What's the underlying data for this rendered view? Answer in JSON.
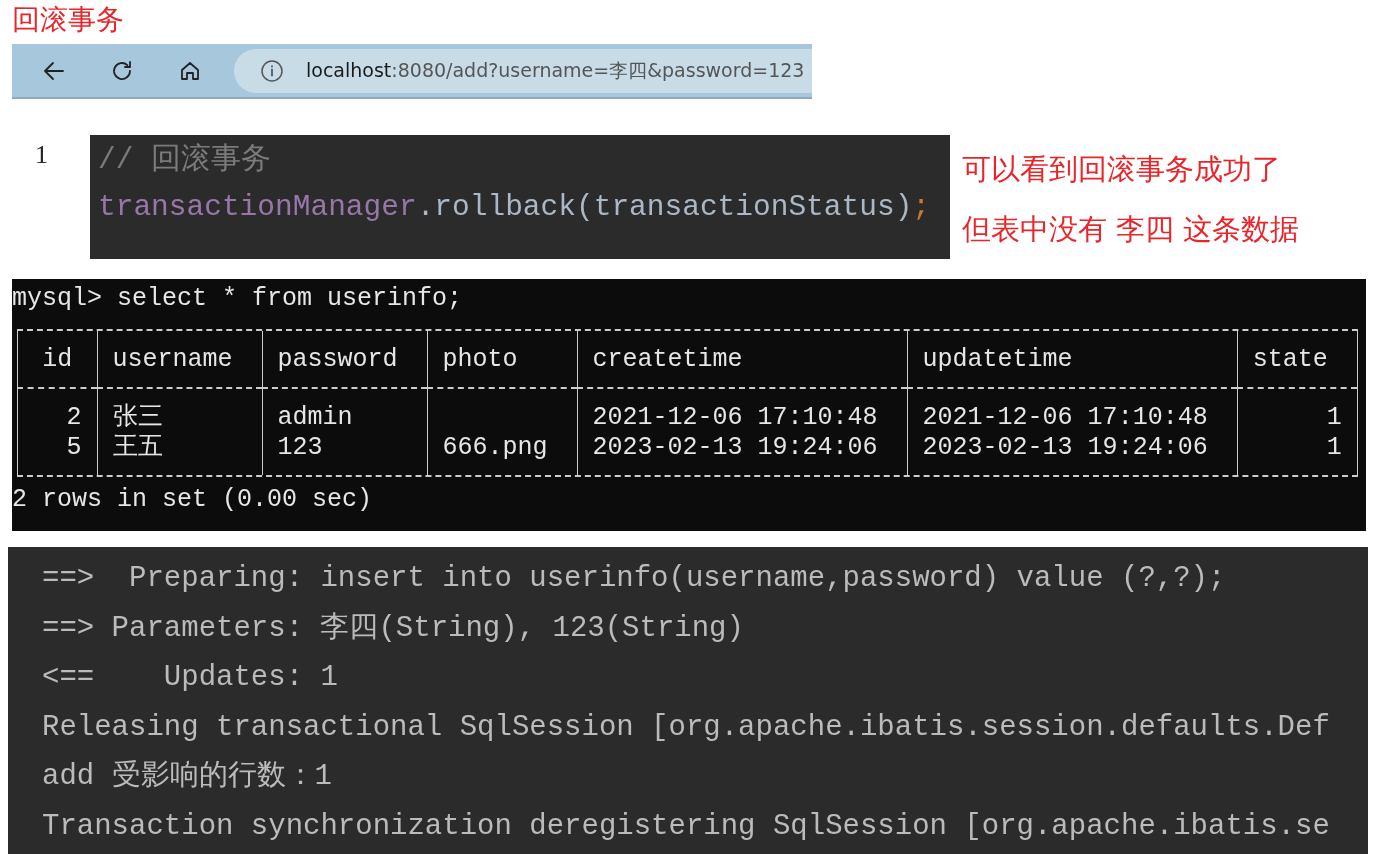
{
  "heading": "回滚事务",
  "browser": {
    "url_host": "localhost",
    "url_rest": ":8080/add?username=李四&password=123"
  },
  "line_number": "1",
  "code_lines": [
    [
      {
        "text": "// 回滚事务",
        "kind": "comment"
      }
    ],
    [
      {
        "text": "transactionManager",
        "kind": "field"
      },
      {
        "text": ".rollback(transactionStatus)",
        "kind": "plain"
      },
      {
        "text": ";",
        "kind": "punct"
      }
    ]
  ],
  "annotations": [
    "可以看到回滚事务成功了",
    "但表中没有 李四 这条数据"
  ],
  "terminal": {
    "command": "mysql> select * from userinfo;",
    "columns": [
      "id",
      "username",
      "password",
      "photo",
      "createtime",
      "updatetime",
      "state"
    ],
    "rows": [
      [
        "2",
        "张三",
        "admin",
        "",
        "2021-12-06 17:10:48",
        "2021-12-06 17:10:48",
        "1"
      ],
      [
        "5",
        "王五",
        "123",
        "666.png",
        "2023-02-13 19:24:06",
        "2023-02-13 19:24:06",
        "1"
      ]
    ],
    "footer": "2 rows in set (0.00 sec)"
  },
  "console": [
    "==>  Preparing: insert into userinfo(username,password) value (?,?);",
    "==> Parameters: 李四(String), 123(String)",
    "<==    Updates: 1",
    "Releasing transactional SqlSession [org.apache.ibatis.session.defaults.Def",
    "add 受影响的行数：1",
    "Transaction synchronization deregistering SqlSession [org.apache.ibatis.se"
  ]
}
